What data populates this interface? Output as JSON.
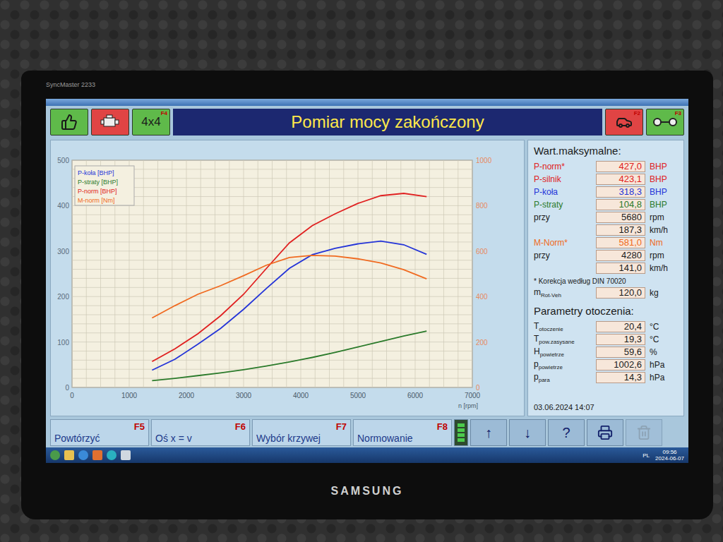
{
  "monitor": {
    "model": "SyncMaster 2233",
    "brand": "SAMSUNG"
  },
  "toolbar_left": [
    {
      "kind": "thumbs-up",
      "key": "",
      "text": "",
      "color": "#5fba4a"
    },
    {
      "kind": "engine",
      "key": "",
      "text": "",
      "color": "#e04444"
    },
    {
      "kind": "text",
      "key": "F4",
      "text": "4x4",
      "color": "#5fba4a"
    }
  ],
  "title": "Pomiar mocy zakończony",
  "toolbar_right": [
    {
      "kind": "car",
      "key": "F2",
      "text": "",
      "color": "#e04444"
    },
    {
      "kind": "trailer",
      "key": "F3",
      "text": "",
      "color": "#5fba4a"
    }
  ],
  "chart": {
    "x_ticks": [
      "0",
      "1000",
      "2000",
      "3000",
      "4000",
      "5000",
      "6000",
      "7000"
    ],
    "y_left_ticks": [
      "0",
      "100",
      "200",
      "300",
      "400",
      "500"
    ],
    "y_right_ticks": [
      "0",
      "200",
      "400",
      "600",
      "800",
      "1000"
    ],
    "x_label": "n [rpm]",
    "rpm": [
      1400,
      1800,
      2200,
      2600,
      3000,
      3400,
      3800,
      4200,
      4600,
      5000,
      5400,
      5800,
      6200
    ],
    "series": [
      {
        "legend": "P-koła [BHP]",
        "color": "#2434d8",
        "axis": "left",
        "values": [
          38,
          62,
          95,
          130,
          172,
          218,
          262,
          292,
          306,
          316,
          322,
          314,
          293
        ]
      },
      {
        "legend": "P-straty [BHP]",
        "color": "#2a7a2a",
        "axis": "left",
        "values": [
          15,
          20,
          26,
          32,
          39,
          47,
          56,
          66,
          77,
          89,
          101,
          113,
          124
        ]
      },
      {
        "legend": "P-norm [BHP]",
        "color": "#e02020",
        "axis": "left",
        "values": [
          57,
          85,
          118,
          158,
          205,
          262,
          318,
          356,
          382,
          405,
          422,
          427,
          420
        ]
      },
      {
        "legend": "M-norm [Nm]",
        "color": "#f06a20",
        "axis": "right",
        "values": [
          306,
          360,
          410,
          448,
          492,
          538,
          572,
          581,
          578,
          566,
          548,
          518,
          478
        ]
      }
    ]
  },
  "max_values": {
    "title": "Wart.maksymalne:",
    "rows": [
      {
        "label": "P-norm*",
        "sub": "",
        "value": "427,0",
        "unit": "BHP",
        "color": "#e02020"
      },
      {
        "label": "P-silnik",
        "sub": "",
        "value": "423,1",
        "unit": "BHP",
        "color": "#e02020"
      },
      {
        "label": "P-koła",
        "sub": "",
        "value": "318,3",
        "unit": "BHP",
        "color": "#2434d8"
      },
      {
        "label": "P-straty",
        "sub": "",
        "value": "104,8",
        "unit": "BHP",
        "color": "#2a7a2a"
      },
      {
        "label": "przy",
        "sub": "",
        "value": "5680",
        "unit": "rpm",
        "color": "#1a1a1a"
      },
      {
        "label": "",
        "sub": "",
        "value": "187,3",
        "unit": "km/h",
        "color": "#1a1a1a"
      },
      {
        "label": "M-Norm*",
        "sub": "",
        "value": "581,0",
        "unit": "Nm",
        "color": "#f06a20"
      },
      {
        "label": "przy",
        "sub": "",
        "value": "4280",
        "unit": "rpm",
        "color": "#1a1a1a"
      },
      {
        "label": "",
        "sub": "",
        "value": "141,0",
        "unit": "km/h",
        "color": "#1a1a1a"
      }
    ]
  },
  "correction_note": "* Korekcja według DIN 70020",
  "mass": {
    "label": "m",
    "sub": "Rot-Veh",
    "value": "120,0",
    "unit": "kg",
    "color": "#1a1a1a"
  },
  "ambient": {
    "title": "Parametry otoczenia:",
    "rows": [
      {
        "label": "T",
        "sub": "otoczenie",
        "value": "20,4",
        "unit": "°C",
        "color": "#1a1a1a"
      },
      {
        "label": "T",
        "sub": "pow.zasysane",
        "value": "19,3",
        "unit": "°C",
        "color": "#1a1a1a"
      },
      {
        "label": "H",
        "sub": "powietrze",
        "value": "59,6",
        "unit": "%",
        "color": "#1a1a1a"
      },
      {
        "label": "p",
        "sub": "powietrze",
        "value": "1002,6",
        "unit": "hPa",
        "color": "#1a1a1a"
      },
      {
        "label": "p",
        "sub": "para",
        "value": "14,3",
        "unit": "hPa",
        "color": "#1a1a1a"
      }
    ]
  },
  "date": "03.06.2024 14:07",
  "function_keys": [
    {
      "key": "F5",
      "label": "Powtórzyć"
    },
    {
      "key": "F6",
      "label": "Oś x = v"
    },
    {
      "key": "F7",
      "label": "Wybór krzywej"
    },
    {
      "key": "F8",
      "label": "Normowanie"
    }
  ],
  "icon_buttons": [
    {
      "kind": "indicator",
      "text": "",
      "disabled": false
    },
    {
      "kind": "glyph",
      "text": "↑",
      "disabled": false
    },
    {
      "kind": "glyph",
      "text": "↓",
      "disabled": false
    },
    {
      "kind": "glyph",
      "text": "?",
      "disabled": false
    },
    {
      "kind": "printer",
      "text": "",
      "disabled": false
    },
    {
      "kind": "bin",
      "text": "",
      "disabled": true
    }
  ],
  "taskbar": {
    "lang": "PL",
    "time": "09:56",
    "date": "2024-06-07"
  }
}
